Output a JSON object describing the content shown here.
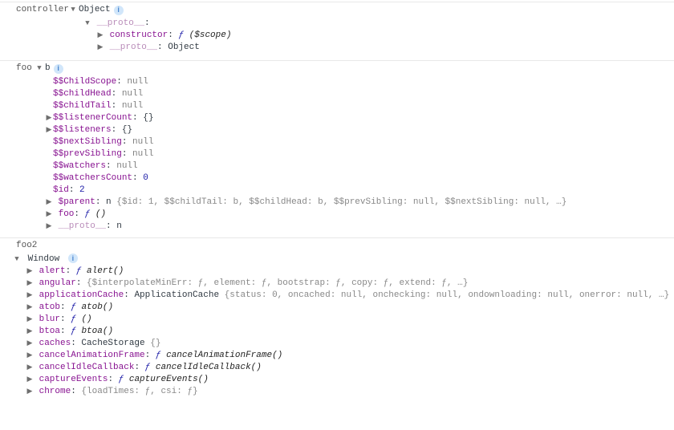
{
  "section1": {
    "label": "controller",
    "type": "Object",
    "proto_label": "__proto__",
    "constructor": {
      "name": "constructor",
      "sig": "($scope)"
    },
    "proto_inner": {
      "name": "__proto__",
      "value": "Object"
    }
  },
  "section2": {
    "label": "foo",
    "type": "b",
    "props": [
      {
        "name": "$$ChildScope",
        "kind": "null",
        "value": "null"
      },
      {
        "name": "$$childHead",
        "kind": "null",
        "value": "null"
      },
      {
        "name": "$$childTail",
        "kind": "null",
        "value": "null"
      },
      {
        "name": "$$listenerCount",
        "kind": "obj",
        "value": "{}",
        "expandable": true
      },
      {
        "name": "$$listeners",
        "kind": "obj",
        "value": "{}",
        "expandable": true
      },
      {
        "name": "$$nextSibling",
        "kind": "null",
        "value": "null"
      },
      {
        "name": "$$prevSibling",
        "kind": "null",
        "value": "null"
      },
      {
        "name": "$$watchers",
        "kind": "null",
        "value": "null"
      },
      {
        "name": "$$watchersCount",
        "kind": "num",
        "value": "0"
      },
      {
        "name": "$id",
        "kind": "num",
        "value": "2"
      }
    ],
    "parent": {
      "name": "$parent",
      "cls": "n",
      "preview": "{$id: 1, $$childTail: b, $$childHead: b, $$prevSibling: null, $$nextSibling: null, …}"
    },
    "foofn": {
      "name": "foo",
      "sig": "()"
    },
    "proto": {
      "name": "__proto__",
      "value": "n"
    }
  },
  "section3": {
    "label": "foo2",
    "type": "Window",
    "props": {
      "alert": {
        "name": "alert",
        "sig": "alert()"
      },
      "angular": {
        "name": "angular",
        "preview": "{$interpolateMinErr: ƒ, element: ƒ, bootstrap: ƒ, copy: ƒ, extend: ƒ, …}"
      },
      "applicationCache": {
        "name": "applicationCache",
        "cls": "ApplicationCache",
        "preview": "{status: 0, oncached: null, onchecking: null, ondownloading: null, onerror: null, …}"
      },
      "atob": {
        "name": "atob",
        "sig": "atob()"
      },
      "blur": {
        "name": "blur",
        "sig": "()"
      },
      "btoa": {
        "name": "btoa",
        "sig": "btoa()"
      },
      "caches": {
        "name": "caches",
        "cls": "CacheStorage",
        "preview": "{}"
      },
      "cancelAnimationFrame": {
        "name": "cancelAnimationFrame",
        "sig": "cancelAnimationFrame()"
      },
      "cancelIdleCallback": {
        "name": "cancelIdleCallback",
        "sig": "cancelIdleCallback()"
      },
      "captureEvents": {
        "name": "captureEvents",
        "sig": "captureEvents()"
      },
      "chrome": {
        "name": "chrome",
        "preview": "{loadTimes: ƒ, csi: ƒ}"
      }
    }
  },
  "glyphs": {
    "right": "▶",
    "down": "▼",
    "f": "ƒ",
    "info": "i"
  }
}
